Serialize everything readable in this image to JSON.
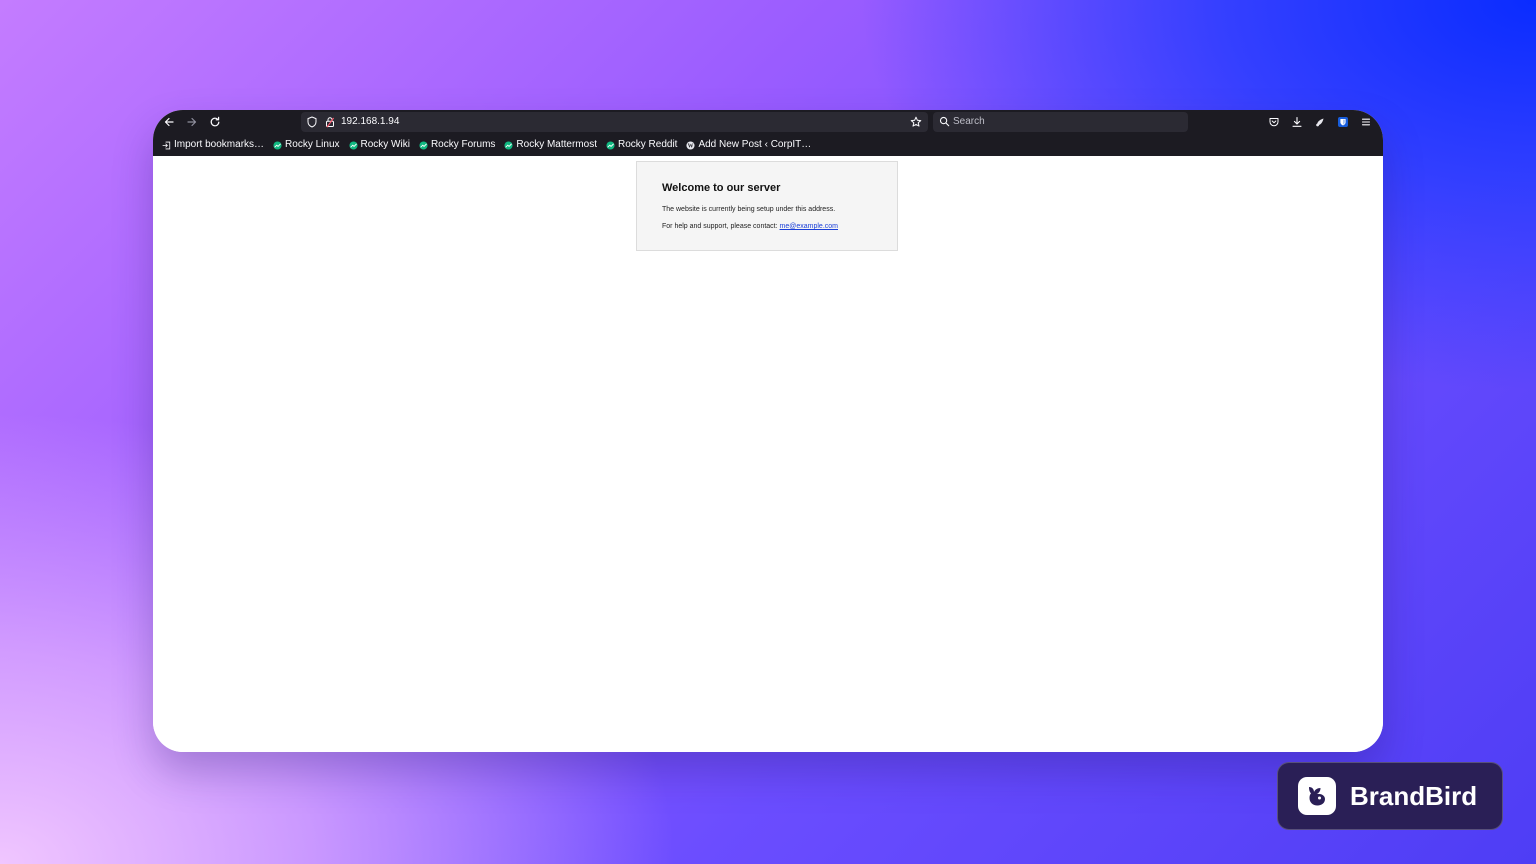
{
  "browser": {
    "url": "192.168.1.94",
    "search_placeholder": "Search",
    "icons": {
      "back": "arrow-left-icon",
      "forward": "arrow-right-icon",
      "reload": "reload-icon",
      "tracking": "shield-icon",
      "connection": "lock-warning-icon",
      "bookmark_star": "star-icon",
      "search": "search-icon",
      "pocket": "pocket-icon",
      "downloads": "download-icon",
      "extension": "extension-icon",
      "bitwarden": "bitwarden-icon",
      "menu": "menu-icon"
    },
    "bookmarks": [
      {
        "label": "Import bookmarks…",
        "icon": "import-icon"
      },
      {
        "label": "Rocky Linux",
        "icon": "rocky-icon"
      },
      {
        "label": "Rocky Wiki",
        "icon": "rocky-icon"
      },
      {
        "label": "Rocky Forums",
        "icon": "rocky-icon"
      },
      {
        "label": "Rocky Mattermost",
        "icon": "rocky-icon"
      },
      {
        "label": "Rocky Reddit",
        "icon": "rocky-icon"
      },
      {
        "label": "Add New Post ‹ CorpIT…",
        "icon": "wordpress-icon"
      }
    ]
  },
  "page": {
    "title": "Welcome to our server",
    "line1": "The website is currently being setup under this address.",
    "line2_prefix": "For help and support, please contact: ",
    "contact_email": "me@example.com"
  },
  "watermark": {
    "brand": "BrandBird"
  },
  "colors": {
    "toolbar": "#1c1b22",
    "field": "#2b2a33",
    "link": "#1a3fd8",
    "rocky_green": "#10b981",
    "bitwarden_blue": "#175ddc"
  }
}
